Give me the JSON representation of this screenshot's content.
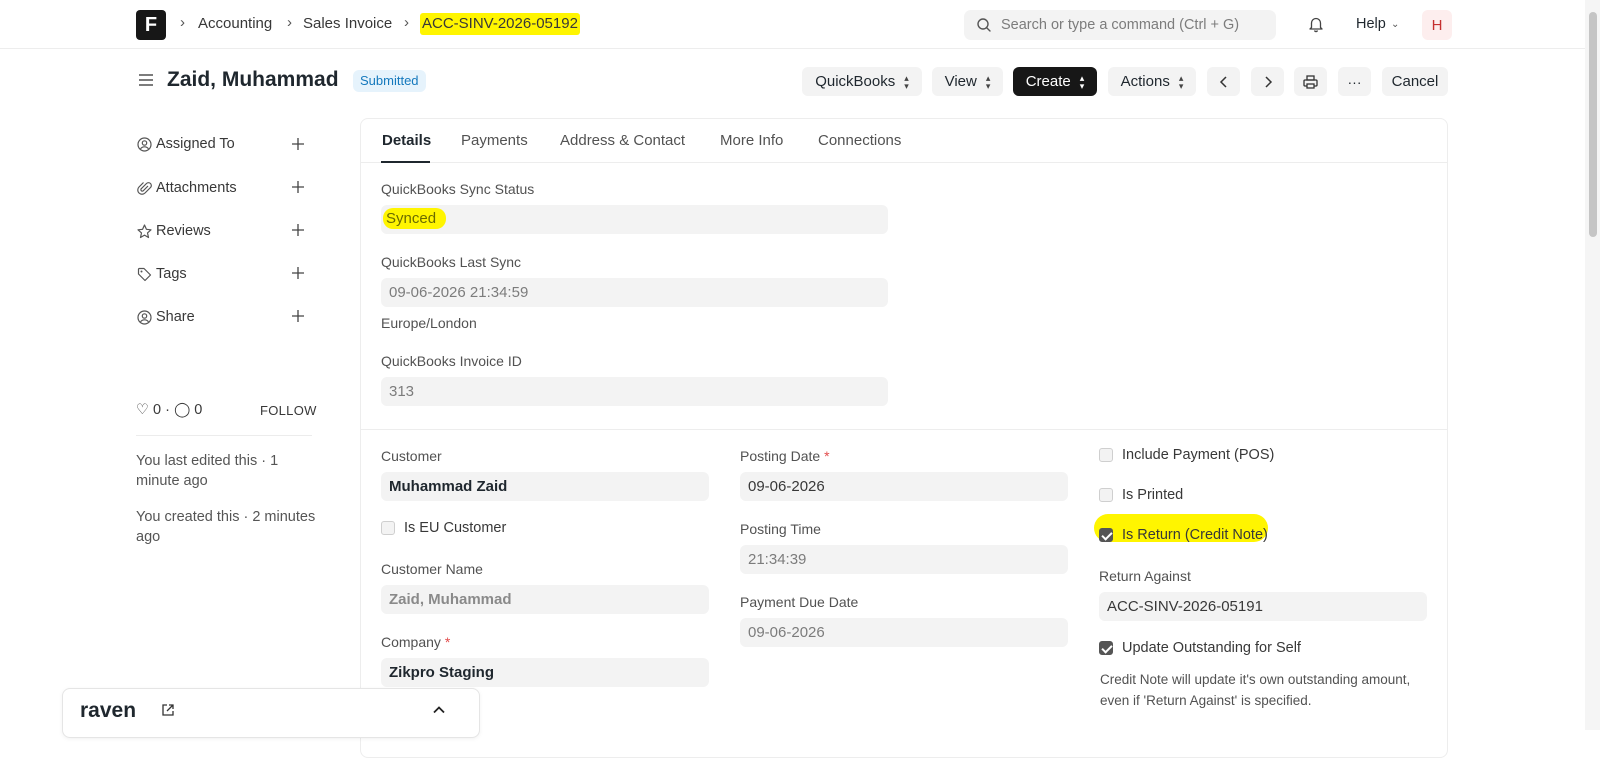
{
  "navbar": {
    "logo": "F",
    "breadcrumbs": [
      "Accounting",
      "Sales Invoice",
      "ACC-SINV-2026-05192"
    ],
    "search_placeholder": "Search or type a command (Ctrl + G)",
    "help_label": "Help",
    "avatar_initial": "H"
  },
  "header": {
    "title": "Zaid, Muhammad",
    "status": "Submitted",
    "buttons": {
      "quickbooks": "QuickBooks",
      "view": "View",
      "create": "Create",
      "actions": "Actions",
      "cancel": "Cancel"
    }
  },
  "sidebar": {
    "items": [
      {
        "label": "Assigned To",
        "icon": "assign-icon"
      },
      {
        "label": "Attachments",
        "icon": "paperclip-icon"
      },
      {
        "label": "Reviews",
        "icon": "star-icon"
      },
      {
        "label": "Tags",
        "icon": "tag-icon"
      },
      {
        "label": "Share",
        "icon": "share-icon"
      }
    ],
    "likes": "0",
    "comments": "0",
    "follow_label": "FOLLOW",
    "activity": [
      "You last edited this · 1 minute ago",
      "You created this · 2 minutes ago"
    ]
  },
  "tabs": [
    "Details",
    "Payments",
    "Address & Contact",
    "More Info",
    "Connections"
  ],
  "details": {
    "qb_sync_status": {
      "label": "QuickBooks Sync Status",
      "value": "Synced"
    },
    "qb_last_sync": {
      "label": "QuickBooks Last Sync",
      "value": "09-06-2026 21:34:59",
      "timezone": "Europe/London"
    },
    "qb_invoice_id": {
      "label": "QuickBooks Invoice ID",
      "value": "313"
    },
    "customer": {
      "label": "Customer",
      "value": "Muhammad Zaid"
    },
    "is_eu_customer": {
      "label": "Is EU Customer",
      "checked": false
    },
    "customer_name": {
      "label": "Customer Name",
      "value": "Zaid, Muhammad"
    },
    "company": {
      "label": "Company",
      "value": "Zikpro Staging"
    },
    "posting_date": {
      "label": "Posting Date",
      "value": "09-06-2026"
    },
    "posting_time": {
      "label": "Posting Time",
      "value": "21:34:39"
    },
    "payment_due_date": {
      "label": "Payment Due Date",
      "value": "09-06-2026"
    },
    "include_payment_pos": {
      "label": "Include Payment (POS)",
      "checked": false
    },
    "is_printed": {
      "label": "Is Printed",
      "checked": false
    },
    "is_return": {
      "label": "Is Return (Credit Note)",
      "checked": true
    },
    "return_against": {
      "label": "Return Against",
      "value": "ACC-SINV-2026-05191"
    },
    "update_outstanding": {
      "label": "Update Outstanding for Self",
      "checked": true,
      "description": "Credit Note will update it's own outstanding amount, even if 'Return Against' is specified."
    }
  },
  "raven": {
    "name": "raven"
  },
  "colors": {
    "highlight": "#fff500",
    "primary_dark": "#171717",
    "badge_bg": "#e6f3fc",
    "badge_text": "#1579bd"
  }
}
